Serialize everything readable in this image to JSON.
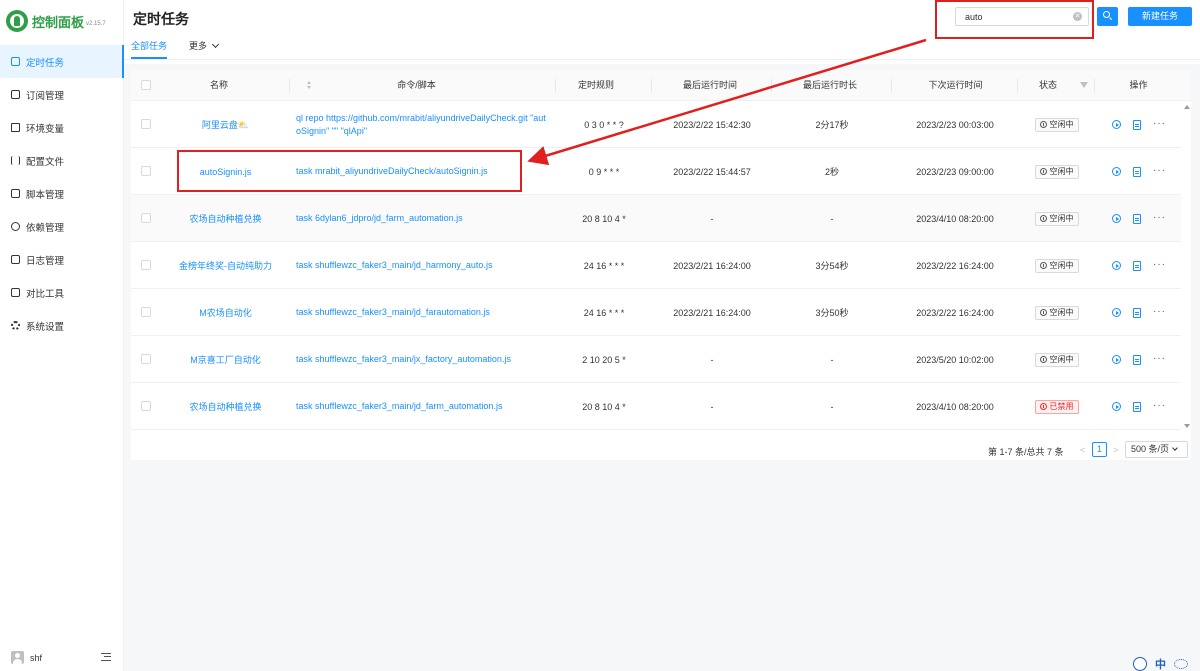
{
  "app": {
    "title": "控制面板",
    "version": "v2.15.7",
    "brand_color": "#2f9f47",
    "accent_color": "#1890ff"
  },
  "sidebar": {
    "items": [
      {
        "label": "定时任务",
        "icon": "calendar-icon",
        "active": true
      },
      {
        "label": "订阅管理",
        "icon": "subscription-icon",
        "active": false
      },
      {
        "label": "环境变量",
        "icon": "monitor-icon",
        "active": false
      },
      {
        "label": "配置文件",
        "icon": "sliders-icon",
        "active": false
      },
      {
        "label": "脚本管理",
        "icon": "script-icon",
        "active": false
      },
      {
        "label": "依赖管理",
        "icon": "dependency-icon",
        "active": false
      },
      {
        "label": "日志管理",
        "icon": "log-icon",
        "active": false
      },
      {
        "label": "对比工具",
        "icon": "diff-icon",
        "active": false
      },
      {
        "label": "系统设置",
        "icon": "gear-icon",
        "active": false
      }
    ],
    "user": "shf"
  },
  "header": {
    "title": "定时任务",
    "search_value": "auto",
    "new_task_label": "新建任务",
    "tabs": [
      {
        "label": "全部任务",
        "active": true
      },
      {
        "label": "更多",
        "active": false
      }
    ]
  },
  "table": {
    "columns": [
      "名称",
      "命令/脚本",
      "定时规则",
      "最后运行时间",
      "最后运行时长",
      "下次运行时间",
      "状态",
      "操作"
    ],
    "rows": [
      {
        "name": "阿里云盘⛅",
        "command": "ql repo https://github.com/mrabit/aliyundriveDailyCheck.git \"autoSignin\" \"\" \"qlApi\"",
        "schedule": "0 3 0 * * ?",
        "last_run": "2023/2/22 15:42:30",
        "duration": "2分17秒",
        "next_run": "2023/2/23 00:03:00",
        "status": "空闲中",
        "status_type": "idle"
      },
      {
        "name": "autoSignin.js",
        "command": "task mrabit_aliyundriveDailyCheck/autoSignin.js",
        "schedule": "0 9 * * *",
        "last_run": "2023/2/22 15:44:57",
        "duration": "2秒",
        "next_run": "2023/2/23 09:00:00",
        "status": "空闲中",
        "status_type": "idle"
      },
      {
        "name": "农场自动种植兑换",
        "command": "task 6dylan6_jdpro/jd_farm_automation.js",
        "schedule": "20 8 10 4 *",
        "last_run": "-",
        "duration": "-",
        "next_run": "2023/4/10 08:20:00",
        "status": "空闲中",
        "status_type": "idle"
      },
      {
        "name": "金榜年终奖-自动纯助力",
        "command": "task shufflewzc_faker3_main/jd_harmony_auto.js",
        "schedule": "24 16 * * *",
        "last_run": "2023/2/21 16:24:00",
        "duration": "3分54秒",
        "next_run": "2023/2/22 16:24:00",
        "status": "空闲中",
        "status_type": "idle"
      },
      {
        "name": "M农场自动化",
        "command": "task shufflewzc_faker3_main/jd_farautomation.js",
        "schedule": "24 16 * * *",
        "last_run": "2023/2/21 16:24:00",
        "duration": "3分50秒",
        "next_run": "2023/2/22 16:24:00",
        "status": "空闲中",
        "status_type": "idle"
      },
      {
        "name": "M京喜工厂自动化",
        "command": "task shufflewzc_faker3_main/jx_factory_automation.js",
        "schedule": "2 10 20 5 *",
        "last_run": "-",
        "duration": "-",
        "next_run": "2023/5/20 10:02:00",
        "status": "空闲中",
        "status_type": "idle"
      },
      {
        "name": "农场自动种植兑换",
        "command": "task shufflewzc_faker3_main/jd_farm_automation.js",
        "schedule": "20 8 10 4 *",
        "last_run": "-",
        "duration": "-",
        "next_run": "2023/4/10 08:20:00",
        "status": "已禁用",
        "status_type": "disabled"
      }
    ]
  },
  "pagination": {
    "summary": "第 1-7 条/总共 7 条",
    "current_page": "1",
    "page_size": "500 条/页"
  },
  "colors": {
    "annotation": "#e02020",
    "disabled_status": "#f5222d"
  },
  "ime": {
    "label": "中"
  }
}
